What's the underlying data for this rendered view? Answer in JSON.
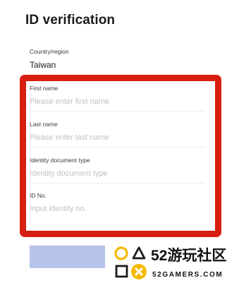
{
  "page": {
    "title": "ID verification"
  },
  "form": {
    "country": {
      "label": "Country/region",
      "value": "Taiwan"
    },
    "first_name": {
      "label": "First name",
      "placeholder": "Please enter first name"
    },
    "last_name": {
      "label": "Last name",
      "placeholder": "Please enter last name"
    },
    "document_type": {
      "label": "Identity document type",
      "placeholder": "Identity document type"
    },
    "id_no": {
      "label": "ID No.",
      "placeholder": "Input identity no."
    }
  },
  "colors": {
    "highlight": "#d61f0f",
    "submit_button": "#b7c4ea",
    "placeholder": "#c2c2c2",
    "watermark_shapes": "#f5b800"
  },
  "watermark": {
    "top_text": "52游玩社区",
    "bottom_text": "52GAMERS.COM",
    "icons": [
      "circle-icon",
      "triangle-icon",
      "square-icon",
      "cross-icon"
    ]
  }
}
